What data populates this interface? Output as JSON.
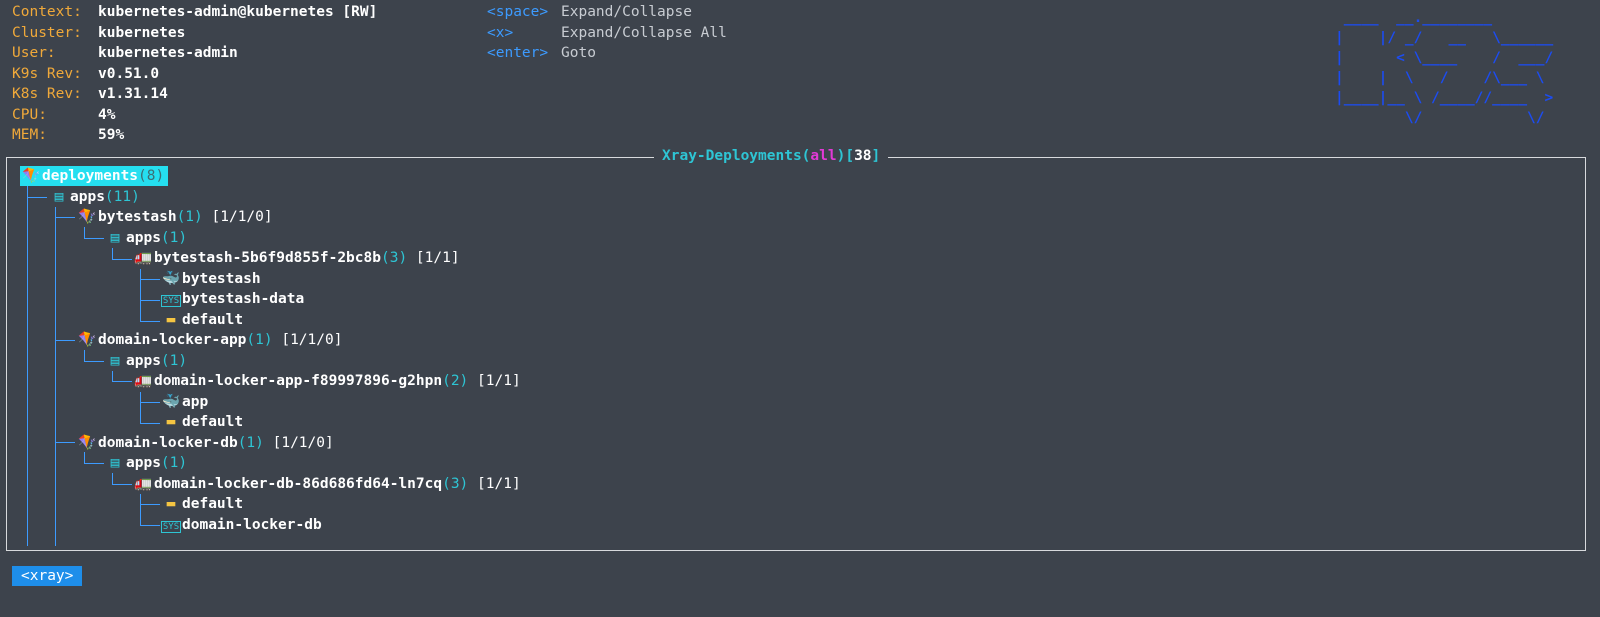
{
  "header": {
    "rows": [
      {
        "key": "Context:",
        "value": "kubernetes-admin@kubernetes [RW]"
      },
      {
        "key": "Cluster:",
        "value": "kubernetes"
      },
      {
        "key": "User:",
        "value": "kubernetes-admin"
      },
      {
        "key": "K9s Rev:",
        "value": "v0.51.0"
      },
      {
        "key": "K8s Rev:",
        "value": "v1.31.14"
      },
      {
        "key": "CPU:",
        "value": "4%"
      },
      {
        "key": "MEM:",
        "value": "59%"
      }
    ]
  },
  "help": [
    {
      "key": "<space>",
      "desc": "Expand/Collapse"
    },
    {
      "key": "<x>",
      "desc": "Expand/Collapse All"
    },
    {
      "key": "<enter>",
      "desc": "Goto"
    }
  ],
  "logo": " ____  __.________\n|    |/ _/   __   \\______\n|      < \\____    /  ___/\n|    |  \\   /    /\\___ \\\n|____|__ \\ /____//____  >\n        \\/            \\/",
  "view": {
    "title_prefix": "Xray-Deployments(",
    "scope": "all",
    "title_mid": ")[",
    "count": "38",
    "title_suffix": "]"
  },
  "tree": [
    {
      "icon": "🪁",
      "icon_name": "deployment-icon",
      "label": "deployments",
      "count": "(8)",
      "status": "",
      "selected": true
    },
    {
      "icon": "▤",
      "icon_name": "namespace-icon",
      "label": "apps",
      "count": "(11)",
      "status": ""
    },
    {
      "icon": "🪁",
      "icon_name": "deployment-icon",
      "label": "bytestash",
      "count": "(1)",
      "status": " [1/1/0]"
    },
    {
      "icon": "▤",
      "icon_name": "namespace-icon",
      "label": "apps",
      "count": "(1)",
      "status": ""
    },
    {
      "icon": "🚛",
      "icon_name": "pod-icon",
      "label": "bytestash-5b6f9d855f-2bc8b",
      "count": "(3)",
      "status": " [1/1]"
    },
    {
      "icon": "🐳",
      "icon_name": "container-icon",
      "label": "bytestash",
      "count": "",
      "status": ""
    },
    {
      "icon": "SYS",
      "icon_name": "volume-icon",
      "label": "bytestash-data",
      "count": "",
      "status": ""
    },
    {
      "icon": "▬",
      "icon_name": "service-account-icon",
      "label": "default",
      "count": "",
      "status": ""
    },
    {
      "icon": "🪁",
      "icon_name": "deployment-icon",
      "label": "domain-locker-app",
      "count": "(1)",
      "status": " [1/1/0]"
    },
    {
      "icon": "▤",
      "icon_name": "namespace-icon",
      "label": "apps",
      "count": "(1)",
      "status": ""
    },
    {
      "icon": "🚛",
      "icon_name": "pod-icon",
      "label": "domain-locker-app-f89997896-g2hpn",
      "count": "(2)",
      "status": " [1/1]"
    },
    {
      "icon": "🐳",
      "icon_name": "container-icon",
      "label": "app",
      "count": "",
      "status": ""
    },
    {
      "icon": "▬",
      "icon_name": "service-account-icon",
      "label": "default",
      "count": "",
      "status": ""
    },
    {
      "icon": "🪁",
      "icon_name": "deployment-icon",
      "label": "domain-locker-db",
      "count": "(1)",
      "status": " [1/1/0]"
    },
    {
      "icon": "▤",
      "icon_name": "namespace-icon",
      "label": "apps",
      "count": "(1)",
      "status": ""
    },
    {
      "icon": "🚛",
      "icon_name": "pod-icon",
      "label": "domain-locker-db-86d686fd64-ln7cq",
      "count": "(3)",
      "status": " [1/1]"
    },
    {
      "icon": "▬",
      "icon_name": "service-account-icon",
      "label": "default",
      "count": "",
      "status": ""
    },
    {
      "icon": "SYS",
      "icon_name": "volume-icon",
      "label": "domain-locker-db",
      "count": "",
      "status": ""
    }
  ],
  "crumb": "<xray>"
}
